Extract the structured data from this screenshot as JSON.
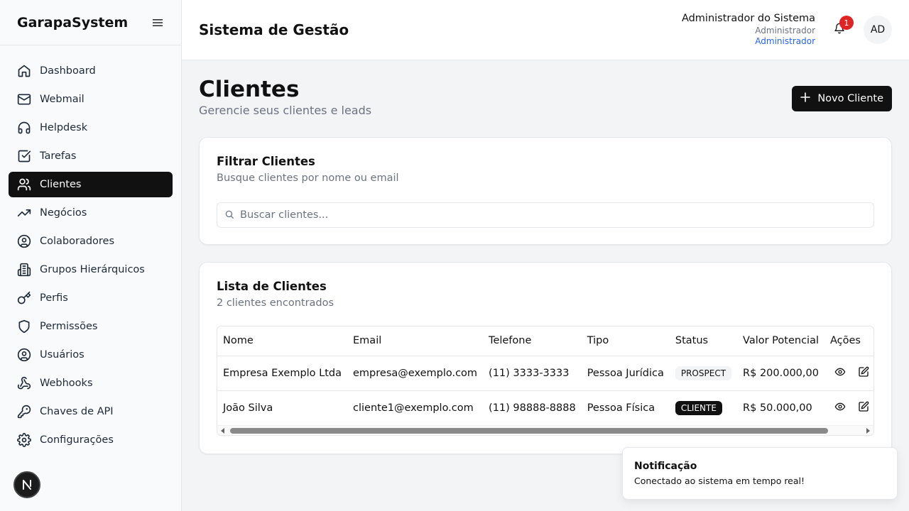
{
  "sidebar": {
    "brand": "GarapaSystem",
    "items": [
      {
        "label": "Dashboard",
        "icon": "home-icon"
      },
      {
        "label": "Webmail",
        "icon": "mail-icon"
      },
      {
        "label": "Helpdesk",
        "icon": "headphones-icon"
      },
      {
        "label": "Tarefas",
        "icon": "checkbox-icon"
      },
      {
        "label": "Clientes",
        "icon": "users-icon",
        "active": true
      },
      {
        "label": "Negócios",
        "icon": "trending-up-icon"
      },
      {
        "label": "Colaboradores",
        "icon": "user-circle-icon"
      },
      {
        "label": "Grupos Hierárquicos",
        "icon": "building-icon"
      },
      {
        "label": "Perfis",
        "icon": "key-icon"
      },
      {
        "label": "Permissões",
        "icon": "shield-icon"
      },
      {
        "label": "Usuários",
        "icon": "user-circle-icon"
      },
      {
        "label": "Webhooks",
        "icon": "webhook-icon"
      },
      {
        "label": "Chaves de API",
        "icon": "key-icon"
      },
      {
        "label": "Configurações",
        "icon": "gear-icon"
      }
    ]
  },
  "header": {
    "title": "Sistema de Gestão",
    "user_name": "Administrador do Sistema",
    "user_role": "Administrador",
    "user_profile": "Administrador",
    "notification_count": "1",
    "avatar_initials": "AD"
  },
  "page": {
    "title": "Clientes",
    "subtitle": "Gerencie seus clientes e leads",
    "new_button": "Novo Cliente"
  },
  "filter": {
    "title": "Filtrar Clientes",
    "description": "Busque clientes por nome ou email",
    "search_placeholder": "Buscar clientes..."
  },
  "list": {
    "title": "Lista de Clientes",
    "count_text": "2 clientes encontrados",
    "columns": [
      "Nome",
      "Email",
      "Telefone",
      "Tipo",
      "Status",
      "Valor Potencial",
      "Ações"
    ],
    "rows": [
      {
        "nome": "Empresa Exemplo Ltda",
        "email": "empresa@exemplo.com",
        "telefone": "(11) 3333-3333",
        "tipo": "Pessoa Jurídica",
        "status": "PROSPECT",
        "valor": "R$ 200.000,00"
      },
      {
        "nome": "João Silva",
        "email": "cliente1@exemplo.com",
        "telefone": "(11) 98888-8888",
        "tipo": "Pessoa Física",
        "status": "CLIENTE",
        "valor": "R$ 50.000,00"
      }
    ]
  },
  "toast": {
    "title": "Notificação",
    "message": "Conectado ao sistema em tempo real!"
  },
  "colors": {
    "primary": "#111111",
    "notification": "#dc2626",
    "link": "#2563eb"
  }
}
